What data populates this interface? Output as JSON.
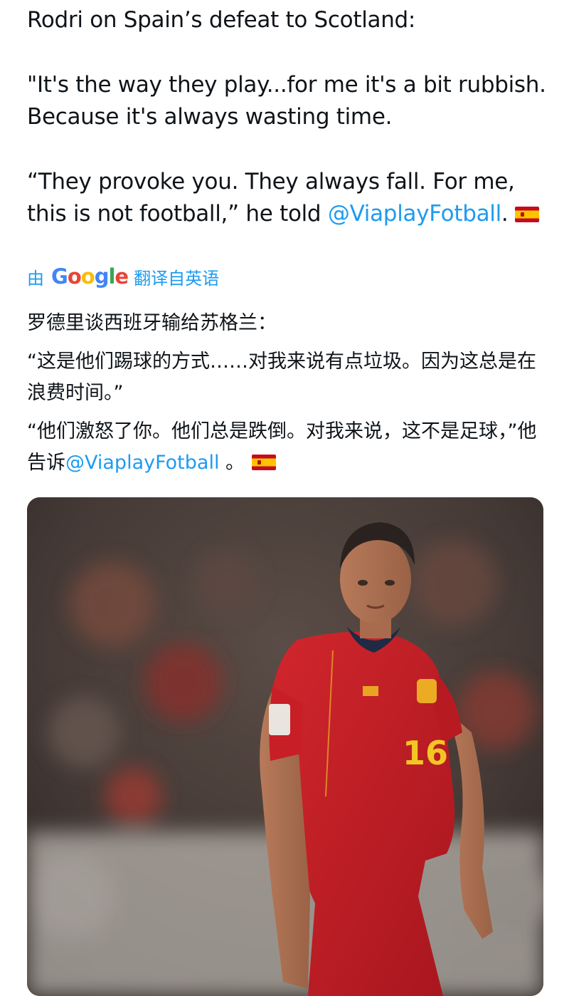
{
  "tweet": {
    "line1": "Rodri on Spain’s defeat to Scotland:",
    "quote1_a": "\"It's the way they play...for me it's a bit rubbish.",
    "quote1_b": "Because it's always wasting time.",
    "quote2_a": "“They provoke you. They always fall. For me,",
    "quote2_b_pre": "this is not football,” he told ",
    "mention": "@ViaplayFotball",
    "quote2_b_post": "."
  },
  "translation_bar": {
    "by": "由",
    "google_letters": [
      "G",
      "o",
      "o",
      "g",
      "l",
      "e"
    ],
    "translated_from": "翻译自英语"
  },
  "translation": {
    "line1": "罗德里谈西班牙输给苏格兰：",
    "para1": "“这是他们踢球的方式……对我来说有点垃圾。因为这总是在浪费时间。”",
    "para2_pre": "“他们激怒了你。他们总是跌倒。对我来说，这不是足球，”他告诉",
    "mention": "@ViaplayFotball",
    "para2_post": " 。"
  },
  "media": {
    "jersey_number": "16"
  },
  "colors": {
    "link": "#1d9bf0",
    "text": "#0f1419",
    "jersey_red": "#c81e26",
    "jersey_yellow": "#f3c623"
  },
  "icons": [
    "flag-spain-icon",
    "google-logo"
  ]
}
